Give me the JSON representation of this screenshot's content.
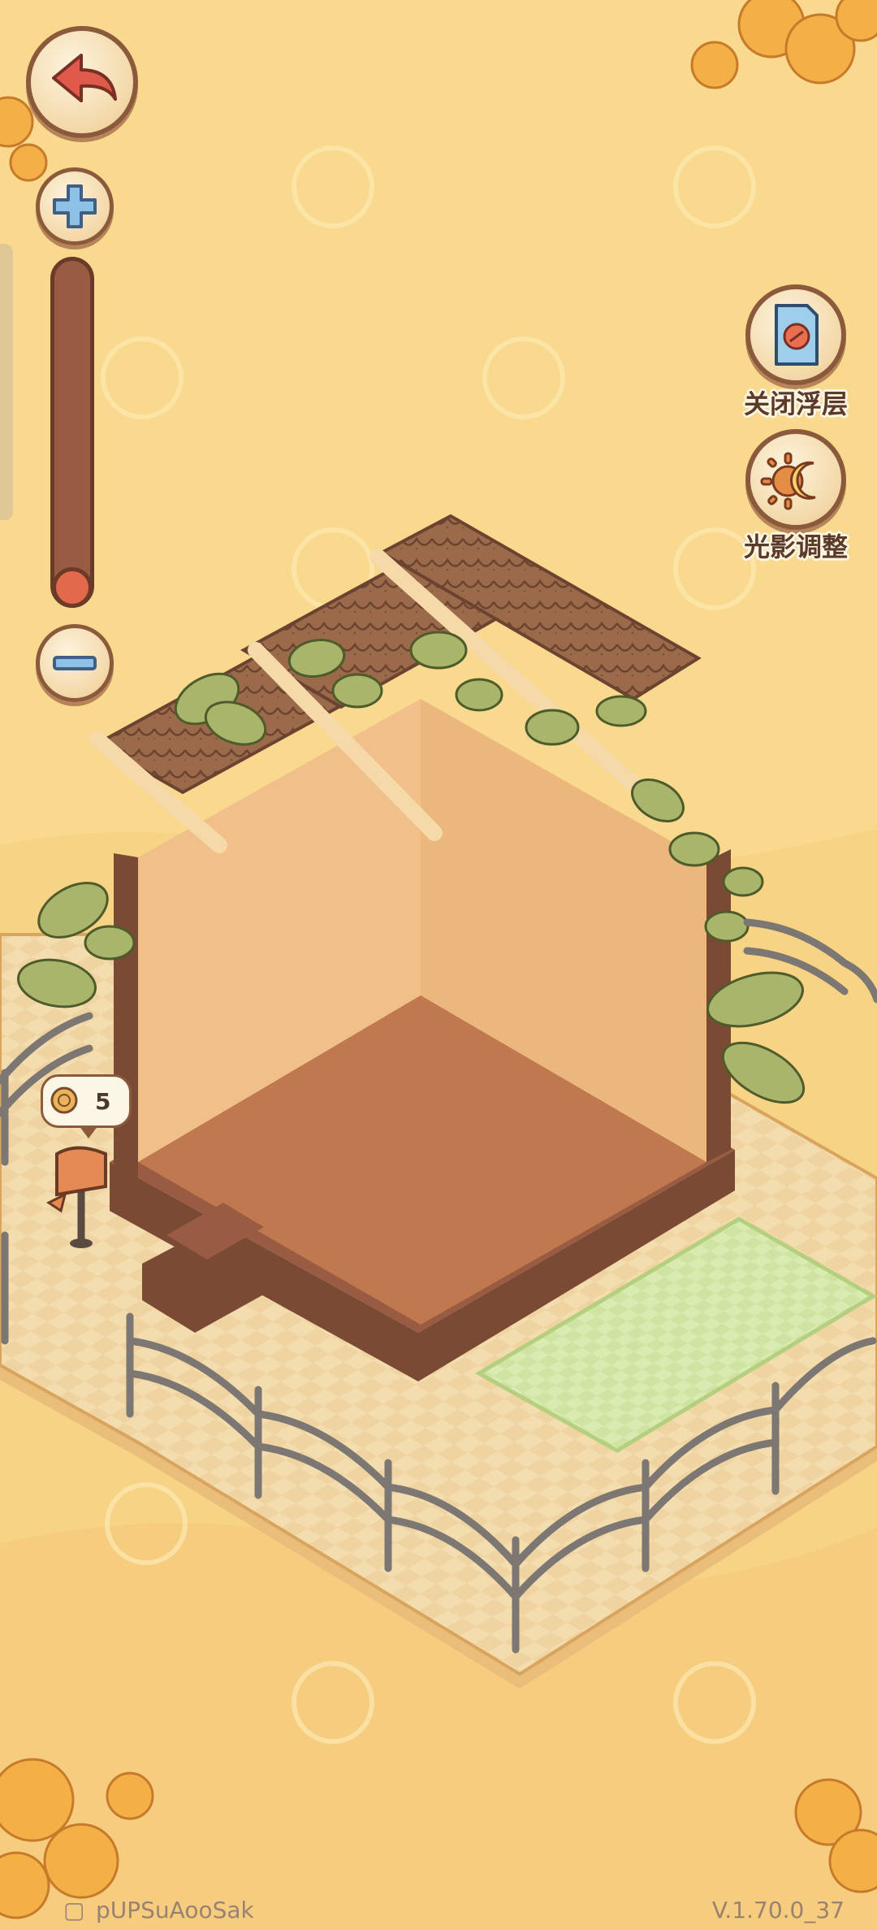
{
  "header": {
    "back_icon": "back-arrow-icon",
    "zoom_in_icon": "plus-icon",
    "zoom_out_icon": "minus-icon",
    "zoom_slider_value": 0.0
  },
  "right_menu": {
    "items": [
      {
        "icon": "document-icon",
        "label": "关闭浮层"
      },
      {
        "icon": "sun-moon-icon",
        "label": "光影调整"
      }
    ]
  },
  "scene": {
    "mailbox_count": "5"
  },
  "footer": {
    "player_id": "pUPSuAooSak",
    "version": "V.1.70.0_37"
  },
  "colors": {
    "background": "#f8d98e",
    "button_border": "#8b5a3c",
    "back_arrow": "#e05a4b",
    "plus_minus": "#8ec1e6",
    "slider_thumb": "#e2694c",
    "label_text": "#5b3a2a"
  }
}
